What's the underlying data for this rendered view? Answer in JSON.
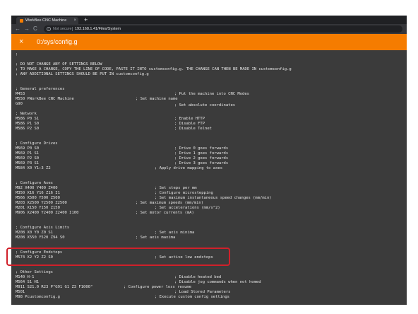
{
  "browser": {
    "tab_title": "WorkBee CNC Machine",
    "tab_close": "×",
    "new_tab": "+",
    "back": "←",
    "forward": "→",
    "reload": "C",
    "info": "i",
    "security_text": "Not secure",
    "url": "192.168.1.41/Files/System"
  },
  "app": {
    "close": "×",
    "title": "0:/sys/config.g"
  },
  "file_lines": [
    {
      "text": ";"
    },
    {
      "text": ""
    },
    {
      "text": "; DO NOT CHANGE ANY OF SETTINGS BELOW"
    },
    {
      "text": "; TO MAKE A CHANGE, COPY THE LINE OF CODE, PASTE IT INTO customconfig.g. THE CHANGE CAN THEN BE MADE IN customconfig.g"
    },
    {
      "text": "; ANY ADDITIONAL SETTINGS SHOULD BE PUT IN customconfig.g"
    },
    {
      "text": ""
    },
    {
      "text": ""
    },
    {
      "text": "; General preferences"
    },
    {
      "text": "M453",
      "comment": "; Put the machine into CNC Modes"
    },
    {
      "text": "M550 PWorkBee CNC Machine",
      "comment": "; Set machine name"
    },
    {
      "text": "G90",
      "comment": "; Set absolute coordinates"
    },
    {
      "text": ""
    },
    {
      "text": "; Network"
    },
    {
      "text": "M586 P0 S1",
      "comment": "; Enable HTTP"
    },
    {
      "text": "M586 P1 S0",
      "comment": "; Disable FTP"
    },
    {
      "text": "M586 P2 S0",
      "comment": "; Disable Telnet"
    },
    {
      "text": ""
    },
    {
      "text": ""
    },
    {
      "text": "; Configure Drives"
    },
    {
      "text": "M569 P0 S0",
      "comment": "; Drive 0 goes forwards"
    },
    {
      "text": "M569 P1 S1",
      "comment": "; Drive 1 goes forwards"
    },
    {
      "text": "M569 P2 S0",
      "comment": "; Drive 2 goes forwards"
    },
    {
      "text": "M569 P3 S1",
      "comment": "; Drive 3 goes forwards"
    },
    {
      "text": "M584 X0 Y1:3 Z2",
      "comment": "; Apply drive mapping to axes"
    },
    {
      "text": ""
    },
    {
      "text": ""
    },
    {
      "text": "; Configure Axes"
    },
    {
      "text": "M92 X400 Y400 Z400",
      "comment": "; Set steps per mm"
    },
    {
      "text": "M350 X16 Y16 Z16 I1",
      "comment": "; Configure microstepping"
    },
    {
      "text": "M566 X500 Y500 Z500",
      "comment": "; Set maximum instantaneous speed changes (mm/min)"
    },
    {
      "text": "M203 X2500 Y2500 Z2500",
      "comment": "; Set maximum speeds (mm/min)"
    },
    {
      "text": "M201 X150 Y150 Z150",
      "comment": "; Set accelerations (mm/s^2)"
    },
    {
      "text": "M906 X2400 Y2400 Z2400 I100",
      "comment": "; Set motor currents (mA)"
    },
    {
      "text": ""
    },
    {
      "text": ""
    },
    {
      "text": "; Configure Axis Limits"
    },
    {
      "text": "M208 X0 Y0 Z0 S1",
      "comment": "; Set axis minima"
    },
    {
      "text": "M208 X550 Y520 Z94 S0",
      "comment": "; Set axis maxima"
    },
    {
      "text": ""
    },
    {
      "text": ""
    },
    {
      "text": "; Configure Endstops"
    },
    {
      "text": "M574 X2 Y2 Z2 S0",
      "comment": "; Set active low endstops"
    },
    {
      "text": ""
    },
    {
      "text": ""
    },
    {
      "text": "; Other Settings"
    },
    {
      "text": "M140 H-1",
      "comment": "; Disable heated bed"
    },
    {
      "text": "M564 S1 H1",
      "comment": "; Disable jog commands when not homed"
    },
    {
      "text": "M911 S21.0 R23 P\"G91 G1 Z3 F1000\"",
      "comment": "; Configure power loss resume"
    },
    {
      "text": "M501",
      "comment": "; Load Stored Parameters"
    },
    {
      "text": "M98 Pcustomconfig.g",
      "comment": "; Execute custom config settings"
    }
  ]
}
